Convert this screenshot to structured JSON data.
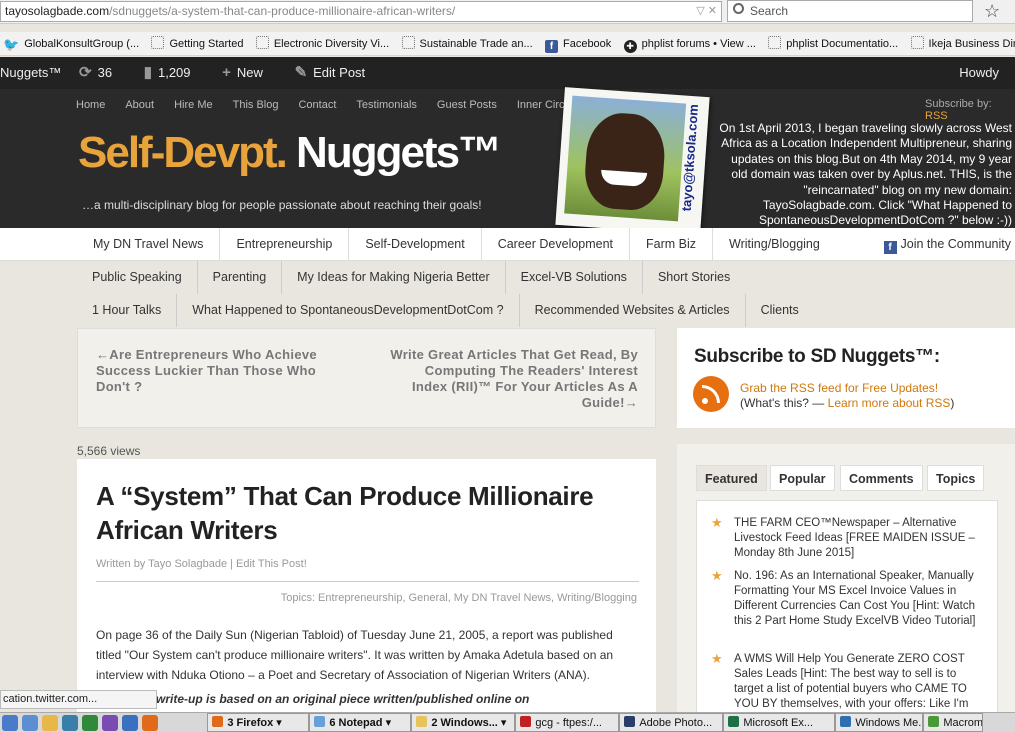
{
  "browser": {
    "url_domain": "tayosolagbade.com",
    "url_path": "/sdnuggets/a-system-that-can-produce-millionaire-african-writers/",
    "url_controls": "▽ ✕",
    "search_placeholder": "Search",
    "star": "☆",
    "bookmarks": [
      "GlobalKonsultGroup (...",
      "Getting Started",
      "Electronic Diversity Vi...",
      "Sustainable Trade an...",
      "Facebook",
      "phplist forums • View ...",
      "phplist Documentatio...",
      "Ikeja Business Direct"
    ],
    "status_link": "cation.twitter.com..."
  },
  "adminbar": {
    "site": "Nuggets™",
    "updates": "36",
    "comments": "1,209",
    "new": "New",
    "edit": "Edit Post",
    "howdy": "Howdy"
  },
  "header": {
    "topnav": [
      "Home",
      "About",
      "Hire Me",
      "This Blog",
      "Contact",
      "Testimonials",
      "Guest Posts",
      "Inner Circle"
    ],
    "subscribe_by": "Subscribe by:",
    "subscribe_rss": "RSS",
    "logo_a": "Self-Devpt.",
    "logo_b": " Nuggets™",
    "tagline": "…a multi-disciplinary blog for people passionate about reaching their goals!",
    "photo_email": "tayo@tksola.com",
    "notice": "On 1st April 2013, I began traveling slowly across West Africa as a Location Independent Multipreneur, sharing updates on this blog.But on 4th May 2014, my 9 year old domain was taken over by Aplus.net. THIS, is the \"reincarnated\" blog on my new domain: TayoSolagbade.com. Click \"What Happened to SpontaneousDevelopmentDotCom ?\" below :-))"
  },
  "nav": {
    "row1": [
      "My DN Travel News",
      "Entrepreneurship",
      "Self-Development",
      "Career Development",
      "Farm Biz",
      "Writing/Blogging"
    ],
    "join": "Join the Community",
    "row2": [
      "Public Speaking",
      "Parenting",
      "My Ideas for Making Nigeria Better",
      "Excel-VB Solutions",
      "Short Stories"
    ],
    "row3": [
      "1 Hour Talks",
      "What Happened to SpontaneousDevelopmentDotCom ?",
      "Recommended Websites & Articles",
      "Clients"
    ]
  },
  "postnav": {
    "prev": "←Are Entrepreneurs Who Achieve Success Luckier Than Those Who Don't ?",
    "next": "Write Great Articles That Get Read, By Computing The Readers' Interest Index (RII)™ For Your Articles As A Guide!→"
  },
  "post": {
    "views": "5,566 views",
    "title": "A “System” That Can Produce Millionaire African Writers",
    "byline": "Written by Tayo Solagbade | Edit This Post!",
    "topics": "Topics: Entrepreneurship, General, My DN Travel News, Writing/Blogging",
    "body": "On page 36 of the Daily Sun (Nigerian Tabloid) of Tuesday June 21, 2005, a report was published titled \"Our System can't produce millionaire writers\". It was written by Amaka Adetula based on an interview with Nduka Otiono – a Poet and Secretary of Association of Nigerian Writers (ANA).",
    "body2": "write-up is based on an original piece written/published online on"
  },
  "sidebar": {
    "subscribe_head": "Subscribe to SD Nuggets™:",
    "rss_line1": "Grab the RSS feed for Free Updates!",
    "rss_line2a": "(What's this? — ",
    "rss_line2b": "Learn more about RSS",
    "rss_line2c": ")",
    "tabs": [
      "Featured",
      "Popular",
      "Comments",
      "Topics"
    ],
    "featured": [
      "THE FARM CEO™Newspaper – Alternative Livestock Feed Ideas [FREE MAIDEN ISSUE – Monday 8th June 2015]",
      "No. 196: As an International Speaker, Manually Formatting Your MS Excel Invoice Values in Different Currencies Can Cost You [Hint: Watch this 2 Part Home Study ExcelVB Video Tutorial]",
      "A WMS Will Help You Generate ZERO COST Sales Leads [Hint: The best way to sell is to target a list of potential buyers who CAME TO YOU BY themselves, with your offers: Like I'm"
    ]
  },
  "taskbar": {
    "items": [
      "3 Firefox",
      "6 Notepad",
      "2 Windows...",
      "gcg - ftpes:/...",
      "Adobe Photo...",
      "Microsoft Ex...",
      "Windows Me...",
      "Macrome"
    ]
  },
  "colors": {
    "accent": "#e8a33a",
    "header_bg": "#2a2a2a",
    "adminbar_bg": "#222222",
    "page_bg": "#e9e6df",
    "facebook": "#3b5998",
    "rss": "#e66f10"
  }
}
